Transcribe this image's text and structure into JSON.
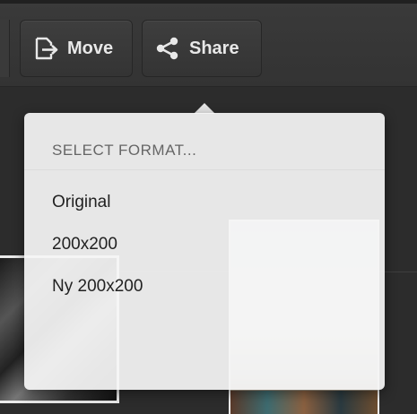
{
  "toolbar": {
    "move_label": "Move",
    "share_label": "Share",
    "move_icon": "move-icon",
    "share_icon": "share-icon"
  },
  "format_menu": {
    "header": "SELECT FORMAT...",
    "options": [
      "Original",
      "200x200",
      "Ny 200x200"
    ]
  },
  "colors": {
    "toolbar_bg": "#363636",
    "popover_bg": "#f5f5f5",
    "text_dark": "#222222",
    "text_muted": "#666666"
  }
}
